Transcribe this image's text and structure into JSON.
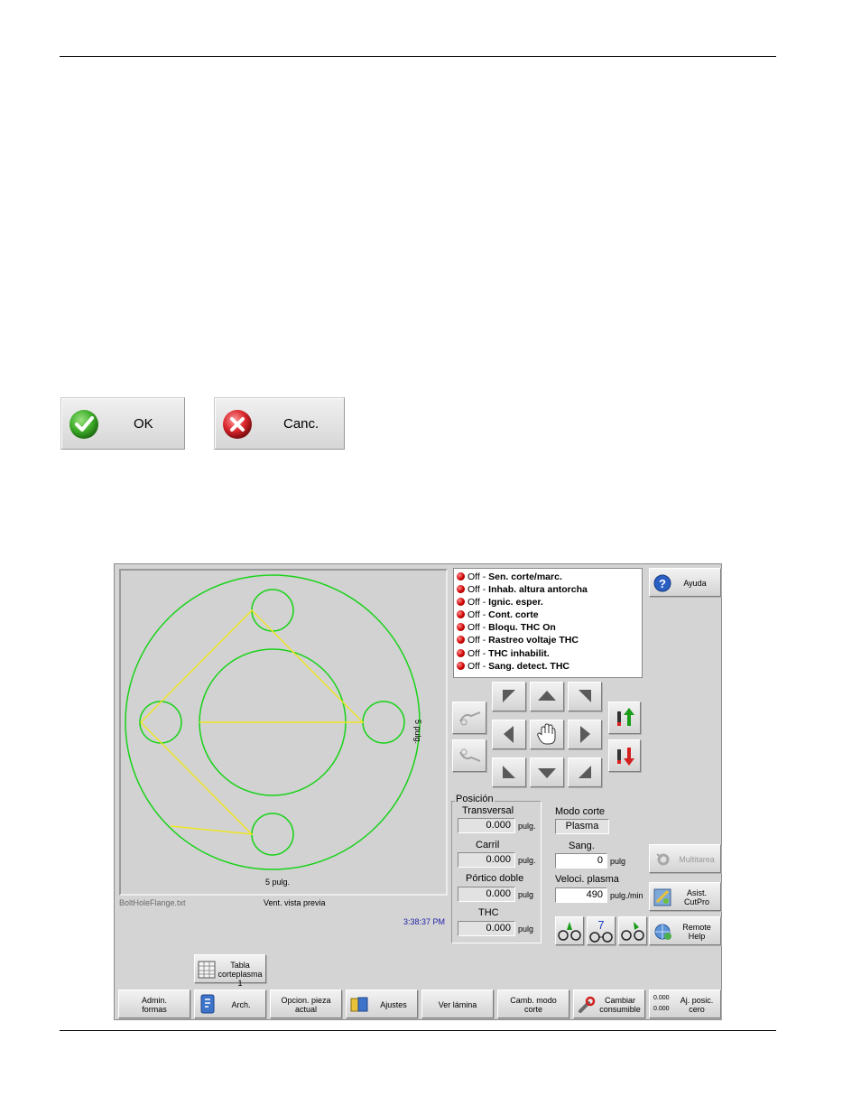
{
  "dialog_buttons": {
    "ok_label": "OK",
    "cancel_label": "Canc."
  },
  "preview": {
    "filename": "BoltHoleFlange.txt",
    "title": "Vent. vista previa",
    "dim_x": "5 pulg.",
    "dim_y": "5 pulg.",
    "time": "3:38:37 PM"
  },
  "status_items": [
    {
      "prefix": "Off - ",
      "label": "Sen. corte/marc."
    },
    {
      "prefix": "Off - ",
      "label": "Inhab. altura antorcha"
    },
    {
      "prefix": "Off - ",
      "label": "Ignic. esper."
    },
    {
      "prefix": "Off - ",
      "label": "Cont. corte"
    },
    {
      "prefix": "Off - ",
      "label": "Bloqu. THC On"
    },
    {
      "prefix": "Off - ",
      "label": "Rastreo voltaje THC"
    },
    {
      "prefix": "Off - ",
      "label": "THC inhabilit."
    },
    {
      "prefix": "Off - ",
      "label": "Sang. detect. THC"
    }
  ],
  "help_button": "Ayuda",
  "position": {
    "group_title": "Posición",
    "transversal_label": "Transversal",
    "transversal_value": "0.000",
    "transversal_unit": "pulg.",
    "carril_label": "Carril",
    "carril_value": "0.000",
    "carril_unit": "pulg.",
    "portico_label": "Pórtico doble",
    "portico_value": "0.000",
    "portico_unit": "pulg",
    "thc_label": "THC",
    "thc_value": "0.000",
    "thc_unit": "pulg"
  },
  "cut": {
    "mode_label": "Modo corte",
    "mode_value": "Plasma",
    "kerf_label": "Sang.",
    "kerf_value": "0",
    "kerf_unit": "pulg",
    "speed_label": "Veloci. plasma",
    "speed_value": "490",
    "speed_unit": "pulg./min"
  },
  "side_buttons": {
    "multitarea": "Multitarea",
    "asist_line1": "Asist.",
    "asist_line2": "CutPro",
    "remote_line1": "Remote",
    "remote_line2": "Help",
    "mid_button_number": "7"
  },
  "tabla_button": {
    "line1": "Tabla",
    "line2": "corteplasma 1"
  },
  "bottom_buttons": {
    "admin_line1": "Admin.",
    "admin_line2": "formas",
    "arch": "Arch.",
    "opcion_line1": "Opcion. pieza",
    "opcion_line2": "actual",
    "ajustes": "Ajustes",
    "ver_lamina": "Ver lámina",
    "camb_line1": "Camb. modo",
    "camb_line2": "corte",
    "cambiar_line1": "Cambiar",
    "cambiar_line2": "consumible",
    "aj_readout_1": "0.000",
    "aj_readout_2": "0.000",
    "aj_line1": "Aj. posic.",
    "aj_line2": "cero"
  },
  "colors": {
    "ok_green": "#3fae2a",
    "cancel_red": "#d9252b",
    "shape_green": "#19d219",
    "path_yellow": "#f0e61e",
    "time_blue": "#1f1fa8",
    "status_red": "#cc0000"
  }
}
